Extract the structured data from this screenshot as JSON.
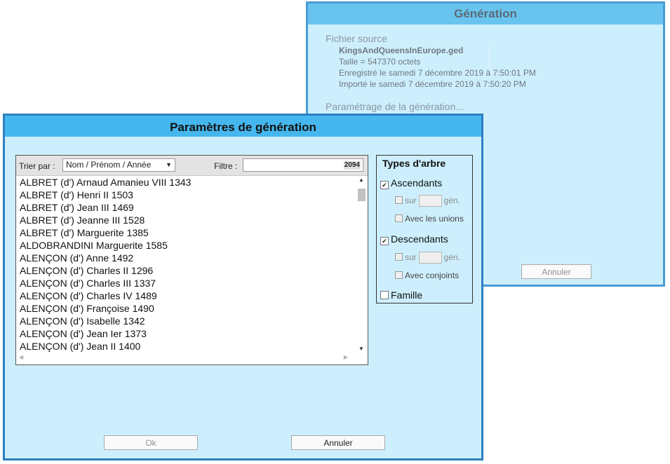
{
  "background_dialog": {
    "title": "Génération",
    "source_section": "Fichier source",
    "file_name": "KingsAndQueensInEurope.ged",
    "file_size": "Taille = 547370 octets",
    "saved": "Enregistré le samedi 7 décembre 2019 à 7:50:01 PM",
    "imported": "Importé le samedi 7 décembre 2019 à 7:50:20 PM",
    "generation_section": "Paramétrage de la génération...",
    "cancel_label": "Annuler"
  },
  "dialog": {
    "title": "Paramètres de génération",
    "sort_label": "Trier par :",
    "sort_value": "Nom / Prénom / Année",
    "filter_label": "Filtre :",
    "filter_value": "",
    "count": "2094",
    "persons": [
      "ALBRET (d')  Arnaud Amanieu VIII  1343",
      "ALBRET (d')  Henri II  1503",
      "ALBRET (d')  Jean III  1469",
      "ALBRET (d')  Jeanne III  1528",
      "ALBRET (d')  Marguerite  1385",
      "ALDOBRANDINI  Marguerite  1585",
      "ALENÇON (d')  Anne  1492",
      "ALENÇON (d')  Charles II  1296",
      "ALENÇON (d')  Charles III  1337",
      "ALENÇON (d')  Charles IV  1489",
      "ALENÇON (d')  Françoise  1490",
      "ALENÇON (d')  Isabelle  1342",
      "ALENÇON (d')  Jean Ier  1373",
      "ALENÇON (d')  Jean II  1400"
    ],
    "types": {
      "title": "Types d'arbre",
      "ascendants": {
        "label": "Ascendants",
        "checked": true
      },
      "asc_sur": "sur",
      "asc_gen": "gén.",
      "asc_unions": "Avec les unions",
      "descendants": {
        "label": "Descendants",
        "checked": true
      },
      "desc_sur": "sur",
      "desc_gen": "gén.",
      "desc_conjoints": "Avec conjoints",
      "famille": {
        "label": "Famille",
        "checked": false
      }
    },
    "ok_label": "Ok",
    "cancel_label": "Annuler"
  }
}
